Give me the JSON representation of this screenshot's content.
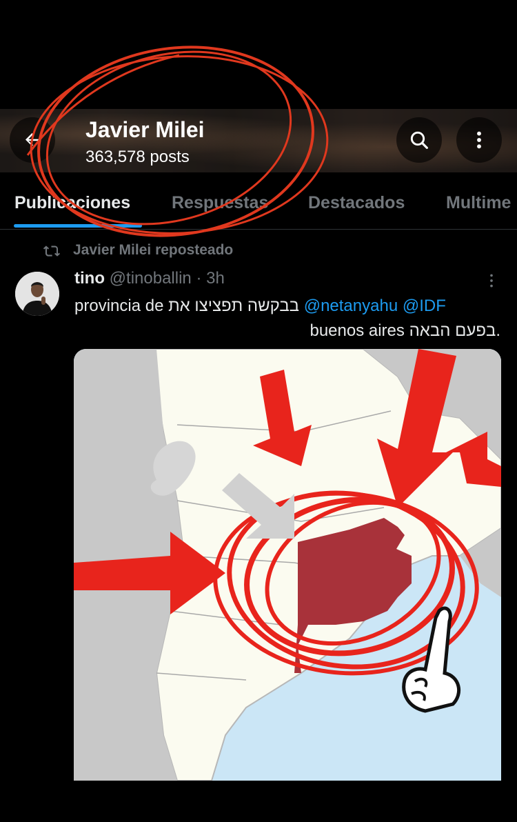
{
  "header": {
    "name": "Javier Milei",
    "posts_count": "363,578 posts",
    "back_icon": "arrow-left-icon",
    "search_icon": "search-icon",
    "more_icon": "more-vertical-icon"
  },
  "tabs": [
    {
      "label": "Publicaciones",
      "active": true
    },
    {
      "label": "Respuestas",
      "active": false
    },
    {
      "label": "Destacados",
      "active": false
    },
    {
      "label": "Multime",
      "active": false
    }
  ],
  "repost": {
    "icon": "repost-icon",
    "label": "Javier Milei reposteado"
  },
  "tweet": {
    "display_name": "tino",
    "handle": "@tinoballin",
    "time": "· 3h",
    "text_line1_plain": "provincia de בבקשה תפציצו את",
    "mention1": "@netanyahu",
    "mention2": "@IDF",
    "text_line2": "buenos aires בפעם הבאה.",
    "media_description_icon": "map-image"
  },
  "colors": {
    "background": "#000000",
    "accent": "#1d9bf0",
    "annotation_red": "#e0381e",
    "map_province": "#a8323a"
  }
}
